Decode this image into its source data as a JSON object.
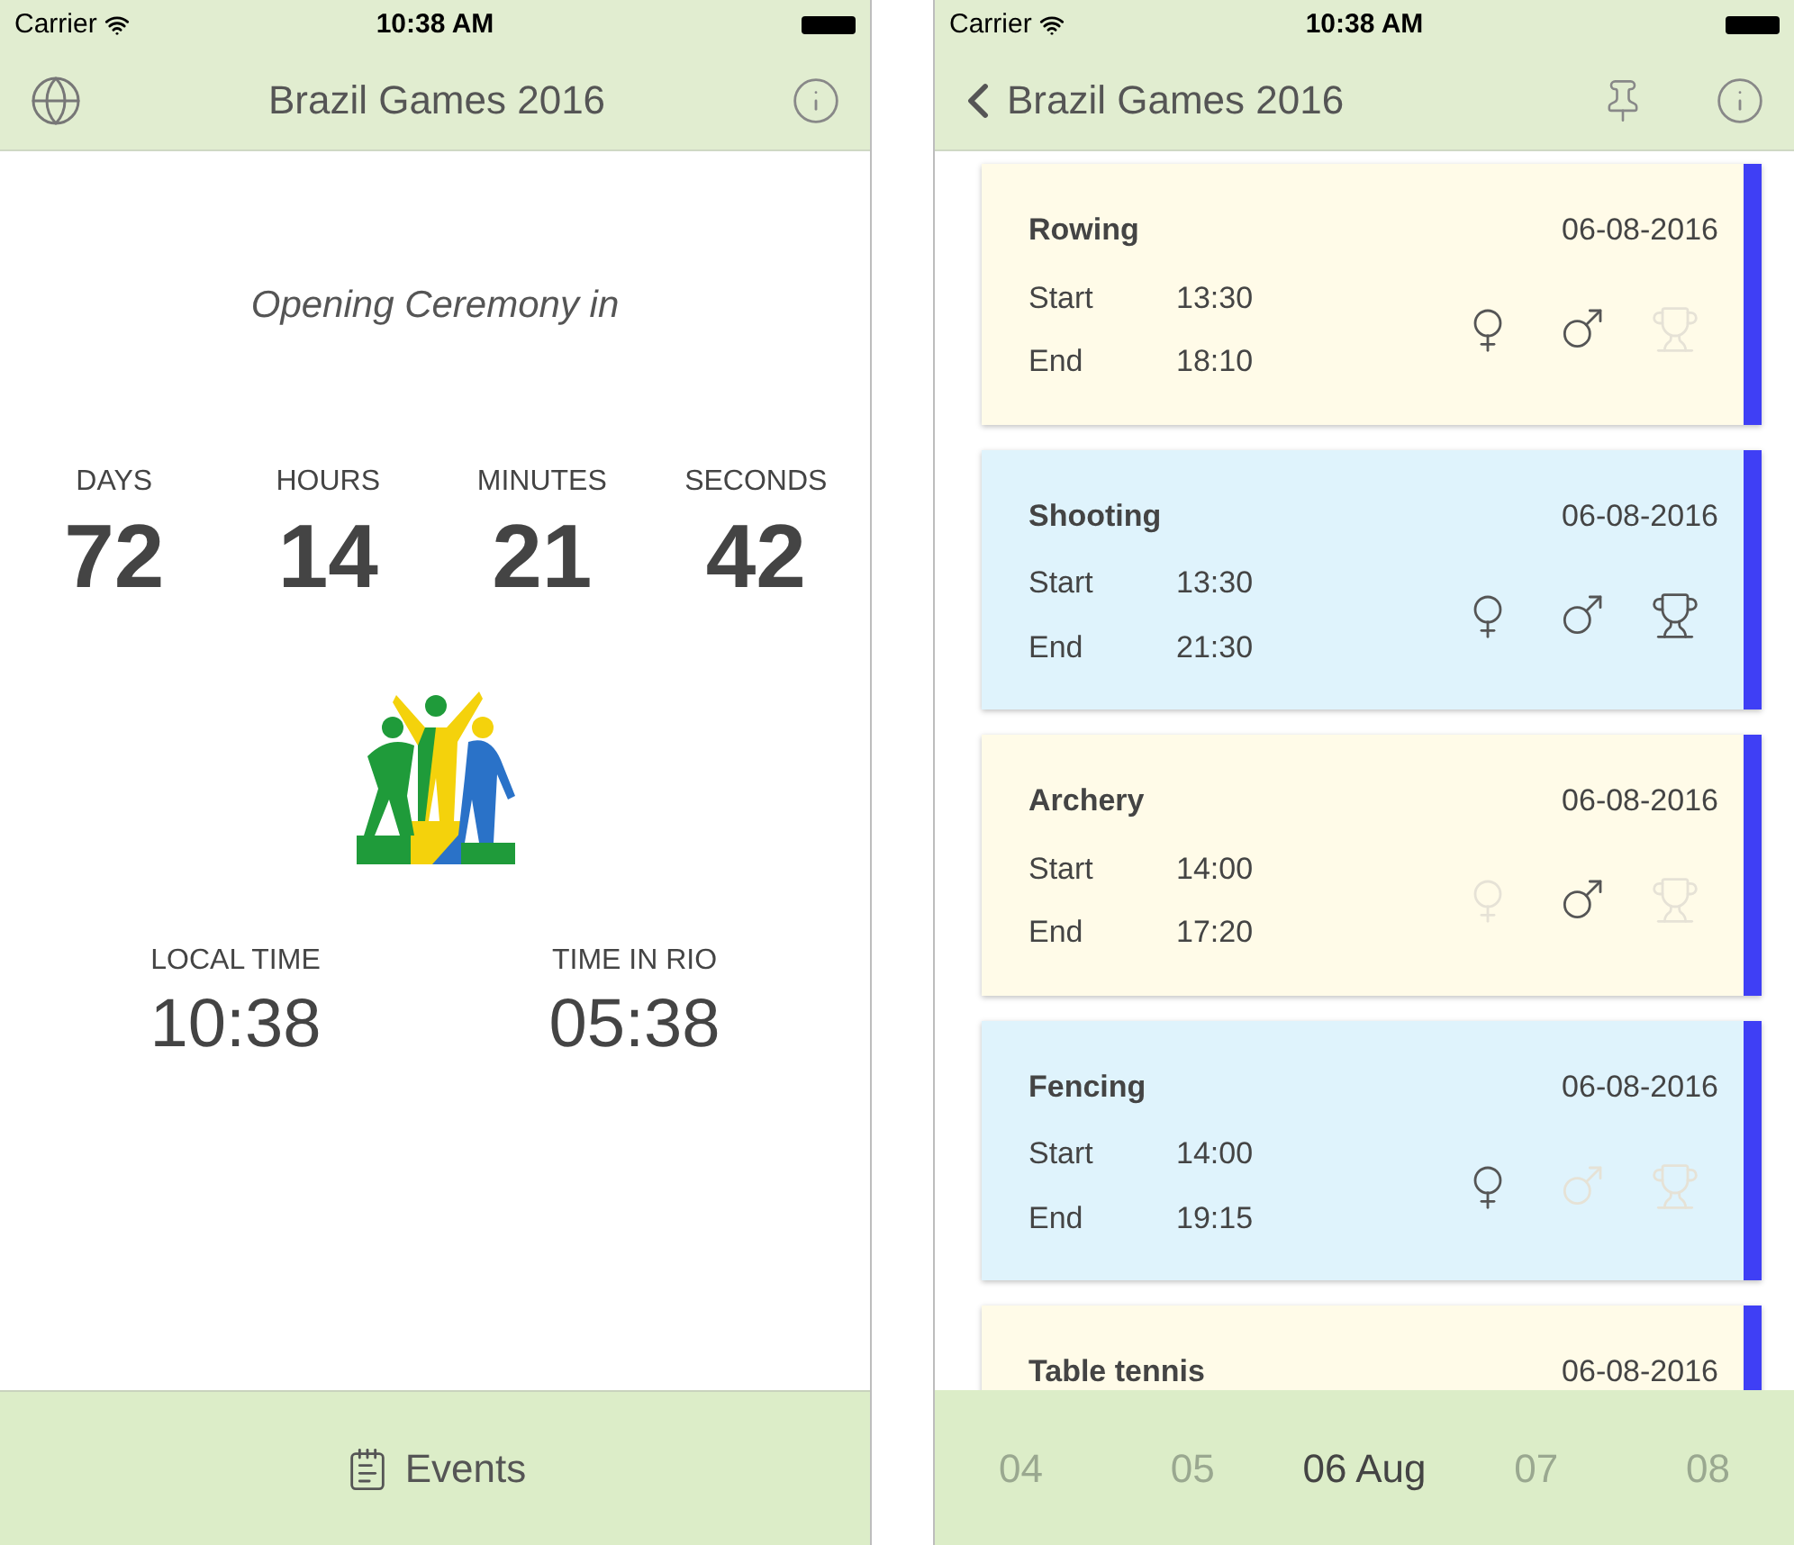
{
  "left_screen": {
    "status_bar": {
      "carrier": "Carrier",
      "time": "10:38 AM"
    },
    "nav_bar": {
      "title": "Brazil Games 2016"
    },
    "countdown": {
      "caption": "Opening Ceremony in",
      "units": [
        {
          "label": "DAYS",
          "value": "72"
        },
        {
          "label": "HOURS",
          "value": "14"
        },
        {
          "label": "MINUTES",
          "value": "21"
        },
        {
          "label": "SECONDS",
          "value": "42"
        }
      ]
    },
    "clocks": [
      {
        "label": "LOCAL TIME",
        "value": "10:38"
      },
      {
        "label": "TIME IN RIO",
        "value": "05:38"
      }
    ],
    "tab_bar": {
      "label": "Events"
    }
  },
  "right_screen": {
    "status_bar": {
      "carrier": "Carrier",
      "time": "10:38 AM"
    },
    "nav_bar": {
      "back_label": "Brazil Games 2016"
    },
    "events": [
      {
        "name": "Rowing",
        "date": "06-08-2016",
        "start_label": "Start",
        "start": "13:30",
        "end_label": "End",
        "end": "18:10",
        "color": "#fffbe8",
        "women": true,
        "men": true,
        "medal": false
      },
      {
        "name": "Shooting",
        "date": "06-08-2016",
        "start_label": "Start",
        "start": "13:30",
        "end_label": "End",
        "end": "21:30",
        "color": "#dff3fc",
        "women": true,
        "men": true,
        "medal": true
      },
      {
        "name": "Archery",
        "date": "06-08-2016",
        "start_label": "Start",
        "start": "14:00",
        "end_label": "End",
        "end": "17:20",
        "color": "#fffbe8",
        "women": false,
        "men": true,
        "medal": false
      },
      {
        "name": "Fencing",
        "date": "06-08-2016",
        "start_label": "Start",
        "start": "14:00",
        "end_label": "End",
        "end": "19:15",
        "color": "#dff3fc",
        "women": true,
        "men": false,
        "medal": false
      },
      {
        "name": "Table tennis",
        "date": "06-08-2016",
        "color": "#fffbe8"
      }
    ],
    "days": [
      {
        "label": "04",
        "selected": false
      },
      {
        "label": "05",
        "selected": false
      },
      {
        "label": "06 Aug",
        "selected": true
      },
      {
        "label": "07",
        "selected": false
      },
      {
        "label": "08",
        "selected": false
      }
    ]
  }
}
